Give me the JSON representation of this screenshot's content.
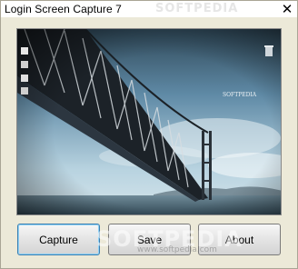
{
  "window": {
    "title": "Login Screen Capture 7",
    "close_glyph": "✕",
    "title_watermark": "SOFTPEDIA"
  },
  "preview": {
    "description_icons": [
      "desktop-icon",
      "desktop-icon",
      "desktop-icon",
      "recycle-bin-icon"
    ],
    "overlay_text": "SOFTPEDIA"
  },
  "buttons": {
    "capture_label": "Capture",
    "save_label": "Save",
    "about_label": "About"
  },
  "watermark": {
    "big": "SOFTPEDIA",
    "small": "www.softpedia.com"
  },
  "colors": {
    "dialog_bg": "#ece9d8",
    "default_button_border": "#3c7fb1",
    "sky_top": "#5f8aa6",
    "sea": "#466273"
  }
}
